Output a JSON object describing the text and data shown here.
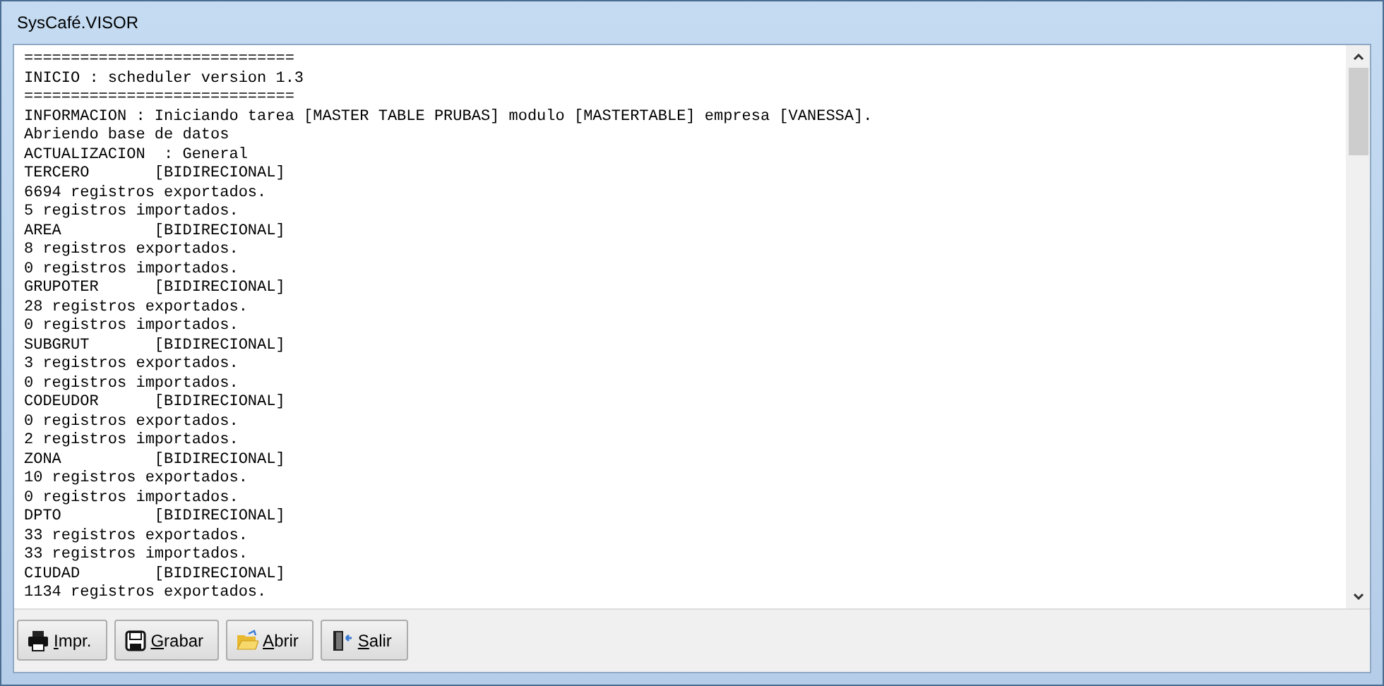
{
  "window": {
    "title": "SysCafé.VISOR"
  },
  "log_lines": [
    "=============================",
    "INICIO : scheduler version 1.3",
    "=============================",
    "INFORMACION : Iniciando tarea [MASTER TABLE PRUBAS] modulo [MASTERTABLE] empresa [VANESSA].",
    "Abriendo base de datos",
    "ACTUALIZACION  : General",
    "TERCERO       [BIDIRECIONAL]",
    "6694 registros exportados.",
    "5 registros importados.",
    "AREA          [BIDIRECIONAL]",
    "8 registros exportados.",
    "0 registros importados.",
    "GRUPOTER      [BIDIRECIONAL]",
    "28 registros exportados.",
    "0 registros importados.",
    "SUBGRUT       [BIDIRECIONAL]",
    "3 registros exportados.",
    "0 registros importados.",
    "CODEUDOR      [BIDIRECIONAL]",
    "0 registros exportados.",
    "2 registros importados.",
    "ZONA          [BIDIRECIONAL]",
    "10 registros exportados.",
    "0 registros importados.",
    "DPTO          [BIDIRECIONAL]",
    "33 registros exportados.",
    "33 registros importados.",
    "CIUDAD        [BIDIRECIONAL]",
    "1134 registros exportados."
  ],
  "buttons": [
    {
      "kind": "print",
      "mnemonic": "I",
      "label": "mpr."
    },
    {
      "kind": "save",
      "mnemonic": "G",
      "label": "rabar"
    },
    {
      "kind": "open",
      "mnemonic": "A",
      "label": "brir"
    },
    {
      "kind": "exit",
      "mnemonic": "S",
      "label": "alir"
    }
  ]
}
